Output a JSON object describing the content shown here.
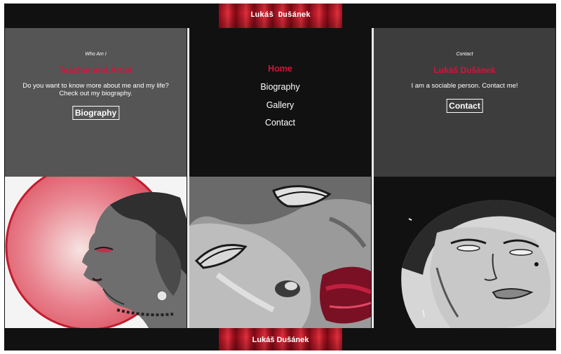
{
  "header": {
    "title": "Lukáš Dušánek"
  },
  "footer": {
    "title": "Lukáš Dušánek"
  },
  "left": {
    "kicker": "Who Am I",
    "heading": "Teacher and Artist",
    "description": "Do you want to know more about me and my life? Check out my biography.",
    "button_label": "Biography"
  },
  "nav": {
    "items": [
      {
        "label": "Home",
        "active": true
      },
      {
        "label": "Biography",
        "active": false
      },
      {
        "label": "Gallery",
        "active": false
      },
      {
        "label": "Contact",
        "active": false
      }
    ]
  },
  "right": {
    "kicker": "Contact",
    "heading": "Lukáš Dušánek",
    "description": "I am a sociable person. Contact me!",
    "button_label": "Contact"
  },
  "colors": {
    "accent": "#d4143a",
    "background": "#111111",
    "panel_grey": "#555555",
    "panel_dark": "#3d3d3d"
  }
}
